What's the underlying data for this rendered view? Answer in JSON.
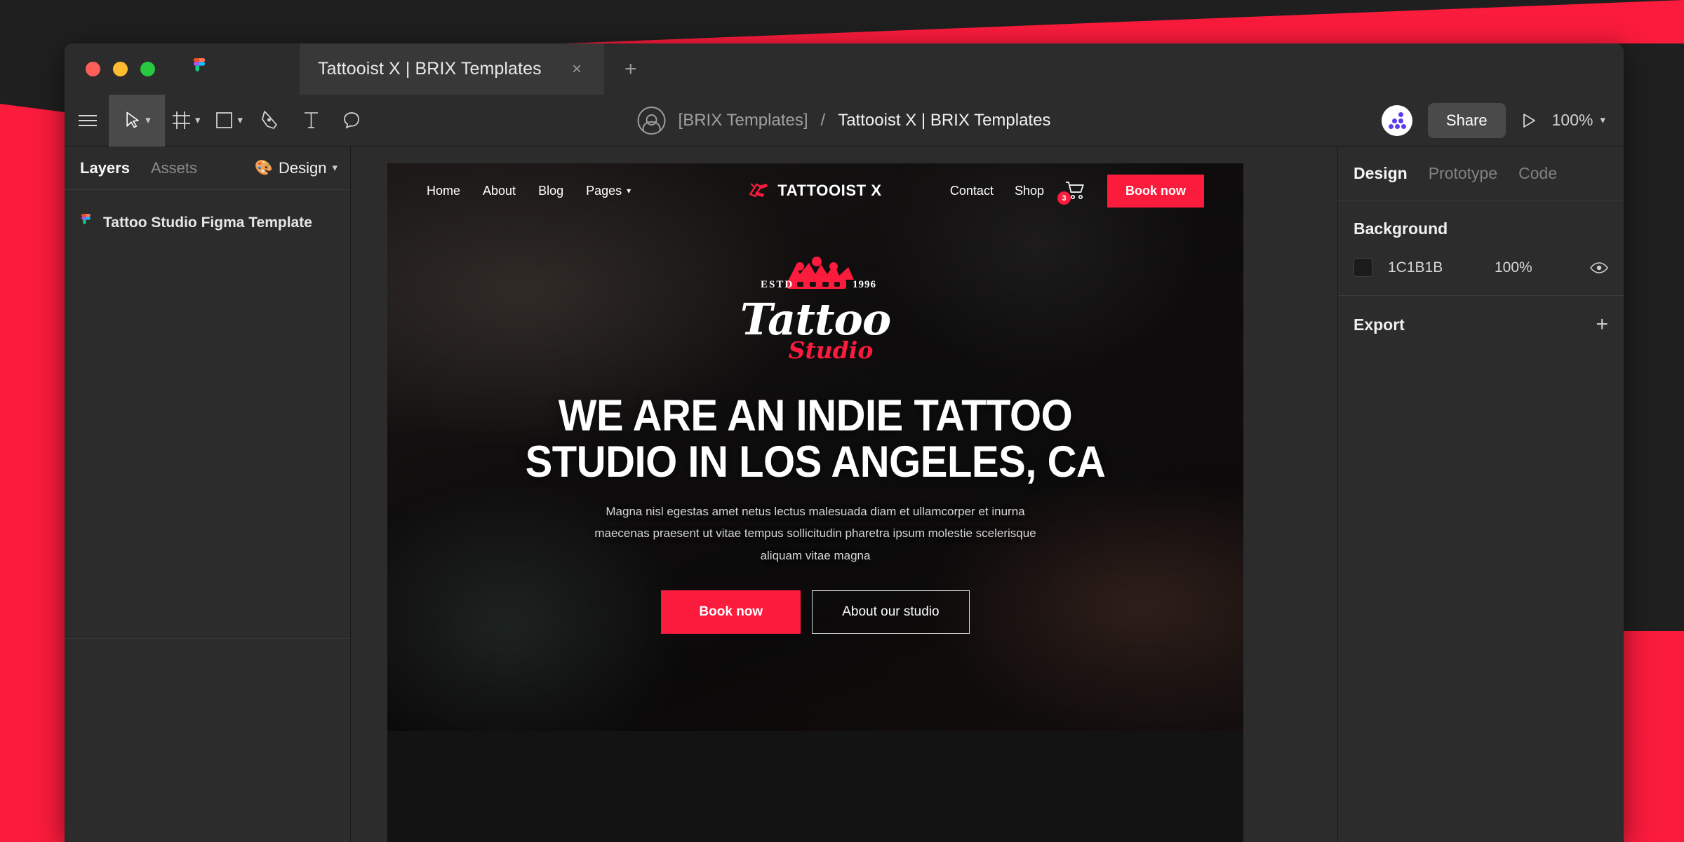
{
  "theme": {
    "accent_red": "#FB1B3C",
    "window_bg": "#2C2C2C",
    "panel_divider": "#3B3B3B",
    "canvas_bg": "#2C2C2C"
  },
  "window": {
    "traffic_lights": [
      "close",
      "minimize",
      "maximize"
    ],
    "app_logo_icon": "figma-logo-icon",
    "tab": {
      "title": "Tattooist X | BRIX Templates",
      "close_label": "×",
      "new_tab_label": "+"
    }
  },
  "toolbar": {
    "menu_icon": "hamburger-menu-icon",
    "tools": [
      {
        "name": "move-tool",
        "icon": "cursor-arrow-icon",
        "active": true,
        "has_caret": true
      },
      {
        "name": "frame-tool",
        "icon": "frame-icon",
        "active": false,
        "has_caret": true
      },
      {
        "name": "shape-tool",
        "icon": "rectangle-icon",
        "active": false,
        "has_caret": true
      },
      {
        "name": "pen-tool",
        "icon": "pen-icon",
        "active": false,
        "has_caret": false
      },
      {
        "name": "text-tool",
        "icon": "text-t-icon",
        "active": false,
        "has_caret": false
      },
      {
        "name": "comment-tool",
        "icon": "comment-bubble-icon",
        "active": false,
        "has_caret": false
      }
    ],
    "breadcrumb": {
      "avatar_icon": "user-avatar-icon",
      "project": "[BRIX Templates]",
      "separator": "/",
      "file": "Tattooist X | BRIX Templates"
    },
    "collaborator_avatar": "multiplayer-avatar",
    "share_label": "Share",
    "present_icon": "play-triangle-icon",
    "zoom_level": "100%",
    "zoom_caret_icon": "chevron-down-icon"
  },
  "left_panel": {
    "tabs": [
      {
        "label": "Layers",
        "active": true
      },
      {
        "label": "Assets",
        "active": false
      }
    ],
    "page_selector": {
      "icon": "palette-icon",
      "label": "Design",
      "caret_icon": "chevron-down-icon"
    },
    "layers": [
      {
        "name": "Tattoo Studio Figma Template",
        "icon": "figma-frame-icon"
      }
    ]
  },
  "right_panel": {
    "tabs": [
      {
        "label": "Design",
        "active": true
      },
      {
        "label": "Prototype",
        "active": false
      },
      {
        "label": "Code",
        "active": false
      }
    ],
    "background": {
      "section_title": "Background",
      "swatch_color": "#1C1B1B",
      "hex": "1C1B1B",
      "opacity": "100%",
      "visibility_icon": "eye-icon"
    },
    "export": {
      "section_title": "Export",
      "add_icon": "plus-icon",
      "add_label": "+"
    }
  },
  "canvas": {
    "frame_name": "Tattoo Studio Figma Template",
    "site": {
      "nav": {
        "left_links": [
          {
            "label": "Home",
            "caret": false
          },
          {
            "label": "About",
            "caret": false
          },
          {
            "label": "Blog",
            "caret": false
          },
          {
            "label": "Pages",
            "caret": true
          }
        ],
        "logo": {
          "mark_icon": "tattoo-machine-icon",
          "text": "TATTOOIST X"
        },
        "right_links": [
          {
            "label": "Contact"
          },
          {
            "label": "Shop"
          }
        ],
        "cart": {
          "icon": "shopping-cart-icon",
          "badge_count": "3"
        },
        "cta_label": "Book now"
      },
      "hero": {
        "logo": {
          "estd_label": "ESTD",
          "year_label": "1996",
          "crown_icon": "crown-icon",
          "word_main": "Tattoo",
          "word_sub": "Studio"
        },
        "headline": "WE ARE AN INDIE TATTOO STUDIO IN LOS ANGELES, CA",
        "subtext": "Magna nisl egestas amet netus lectus malesuada diam et ullamcorper et inurna maecenas praesent ut vitae tempus sollicitudin pharetra ipsum molestie scelerisque aliquam vitae magna",
        "primary_cta": "Book now",
        "secondary_cta": "About our studio"
      }
    }
  }
}
